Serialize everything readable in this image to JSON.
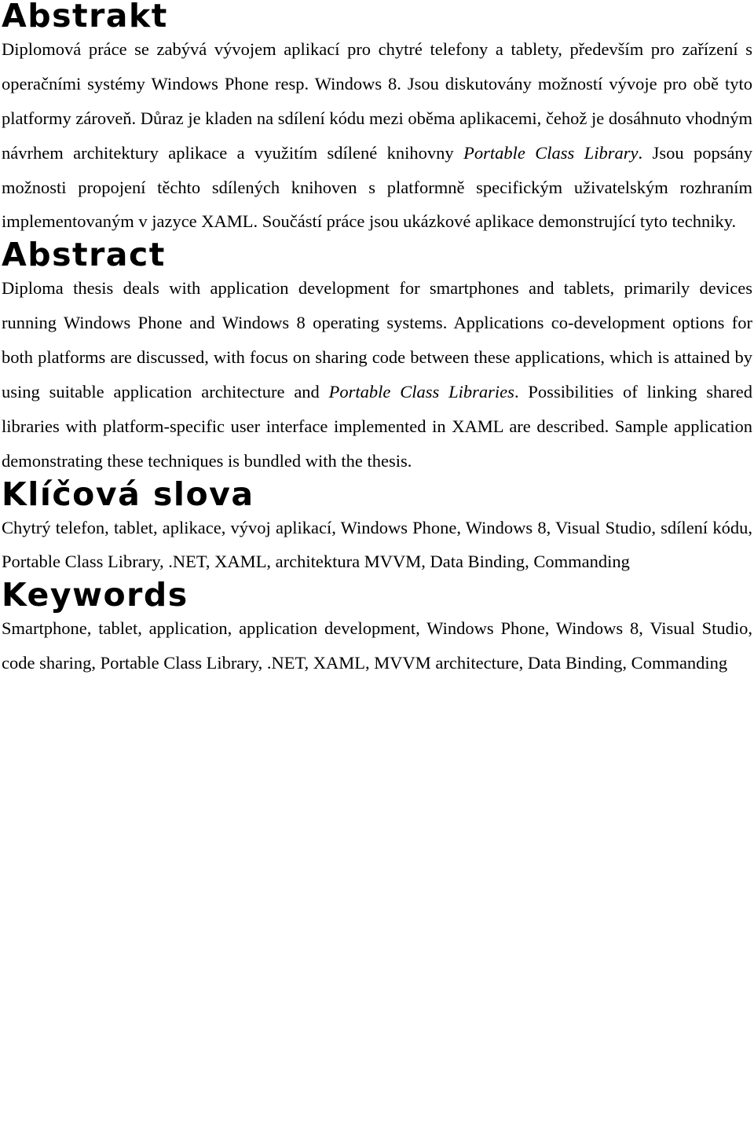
{
  "document": {
    "sections": [
      {
        "id": "abstrakt",
        "heading": "Abstrakt",
        "paragraphs": [
          {
            "runs": [
              {
                "text": "Diplomová práce se zabývá vývojem aplikací pro chytré telefony a tablety, především pro zařízení s operačními systémy Windows Phone resp. Windows 8. Jsou diskutovány možností vývoje pro obě tyto platformy zároveň. Důraz je kladen na sdílení kódu mezi oběma aplikacemi, čehož je dosáhnuto vhodným návrhem architektury aplikace a využitím sdílené knihovny ",
                "style": "normal"
              },
              {
                "text": "Portable Class Library",
                "style": "italic"
              },
              {
                "text": ". Jsou popsány možnosti propojení těchto sdílených knihoven s platformně specifickým uživatelským rozhraním implementovaným v jazyce XAML. Součástí práce jsou ukázkové aplikace demonstrující tyto techniky.",
                "style": "normal"
              }
            ]
          }
        ]
      },
      {
        "id": "abstract",
        "heading": "Abstract",
        "paragraphs": [
          {
            "runs": [
              {
                "text": "Diploma thesis deals with application development for smartphones and tablets, primarily devices running Windows Phone and Windows 8 operating systems. Applications co-development options for both platforms are discussed, with focus on sharing code between these applications, which is attained by using suitable application architecture and ",
                "style": "normal"
              },
              {
                "text": "Portable Class Libraries",
                "style": "italic"
              },
              {
                "text": ". Possibilities of linking shared libraries with platform-specific user interface implemented in XAML are described. Sample application demonstrating these techniques is bundled with the thesis.",
                "style": "normal"
              }
            ]
          }
        ]
      },
      {
        "id": "klicova-slova",
        "heading": "Klíčová slova",
        "paragraphs": [
          {
            "runs": [
              {
                "text": "Chytrý telefon, tablet, aplikace, vývoj aplikací, Windows Phone, Windows 8, Visual Studio, sdílení kódu, Portable Class Library, .NET, XAML, architektura MVVM, Data Binding, Commanding",
                "style": "normal"
              }
            ]
          }
        ]
      },
      {
        "id": "keywords",
        "heading": "Keywords",
        "paragraphs": [
          {
            "runs": [
              {
                "text": "Smartphone, tablet, application, application development, Windows Phone, Windows 8, Visual Studio, code sharing, Portable Class Library, .NET, XAML, MVVM architecture, Data Binding, Commanding",
                "style": "normal"
              }
            ]
          }
        ]
      }
    ]
  }
}
